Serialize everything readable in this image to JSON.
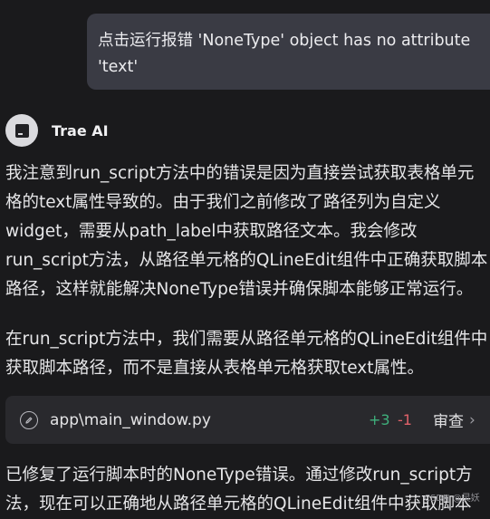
{
  "user_message": {
    "text": "点击运行报错 'NoneType' object has no attribute\n'text'"
  },
  "assistant": {
    "name": "Trae AI",
    "paragraph1": [
      "我注意到run_script方法中的错误是因为直接尝试获取表格单元",
      "格的text属性导致的。由于我们之前修改了路径列为自定义",
      "widget，需要从path_label中获取路径文本。我会修改",
      "run_script方法，从路径单元格的QLineEdit组件中正确获取脚本",
      "路径，这样就能解决NoneType错误并确保脚本能够正常运行。"
    ],
    "paragraph2": [
      "在run_script方法中，我们需要从路径单元格的QLineEdit组件中",
      "获取脚本路径，而不是直接从表格单元格获取text属性。"
    ],
    "file_card": {
      "icon": "edit-pencil-icon",
      "path": "app\\main_window.py",
      "additions": "+3",
      "deletions": "-1",
      "review_label": "审查"
    },
    "paragraph3": [
      "已修复了运行脚本时的NoneType错误。通过修改run_script方",
      "法，现在可以正确地从路径单元格的QLineEdit组件中获取脚本"
    ]
  },
  "watermark": "CSDN @灵妖",
  "colors": {
    "background": "#1a1a1c",
    "bubble": "#3a3b44",
    "card": "#29292d",
    "additions": "#3fb07c",
    "deletions": "#e0626a"
  }
}
